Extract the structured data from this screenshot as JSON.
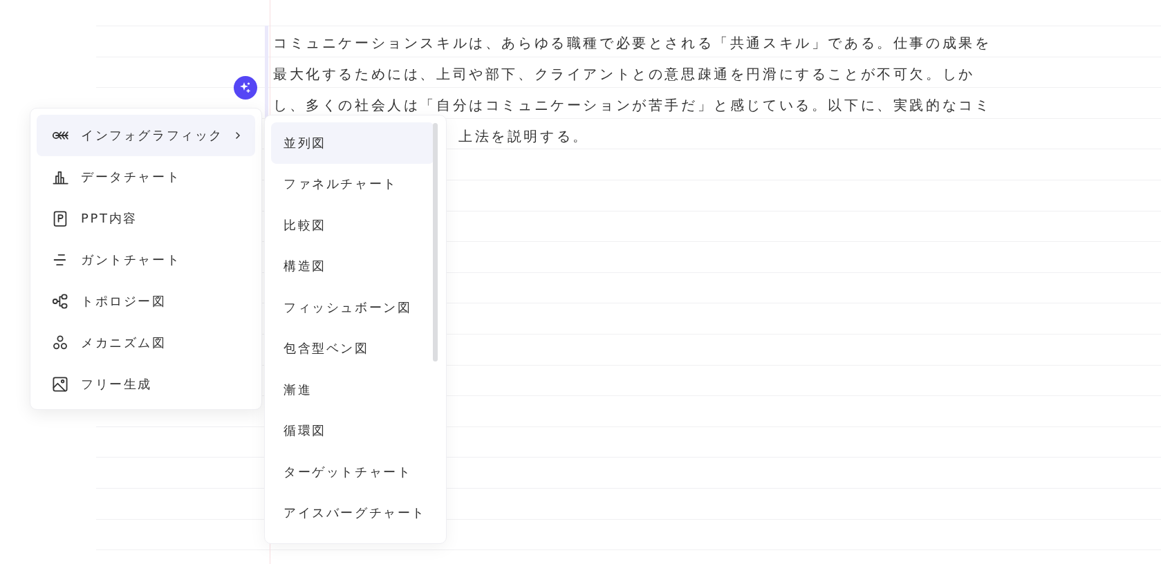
{
  "paragraph": {
    "lines": [
      "コミュニケーションスキルは、あらゆる職種で必要とされる「共通スキル」である。仕事の成果を",
      "最大化するためには、上司や部下、クライアントとの意思疎通を円滑にすることが不可欠。しか",
      "し、多くの社会人は「自分はコミュニケーションが苦手だ」と感じている。以下に、実践的なコミ"
    ],
    "visible_tail": "上法を説明する。"
  },
  "menu": {
    "items": [
      {
        "label": "インフォグラフィック",
        "kind": "fishbone",
        "selected": true,
        "submenu": true
      },
      {
        "label": "データチャート",
        "kind": "bars",
        "selected": false,
        "submenu": false
      },
      {
        "label": "PPT内容",
        "kind": "document",
        "selected": false,
        "submenu": false
      },
      {
        "label": "ガントチャート",
        "kind": "gantt",
        "selected": false,
        "submenu": false
      },
      {
        "label": "トポロジー図",
        "kind": "topology",
        "selected": false,
        "submenu": false
      },
      {
        "label": "メカニズム図",
        "kind": "circles",
        "selected": false,
        "submenu": false
      },
      {
        "label": "フリー生成",
        "kind": "image",
        "selected": false,
        "submenu": false
      }
    ]
  },
  "submenu": {
    "items": [
      {
        "label": "並列図",
        "selected": true
      },
      {
        "label": "ファネルチャート",
        "selected": false
      },
      {
        "label": "比較図",
        "selected": false
      },
      {
        "label": "構造図",
        "selected": false
      },
      {
        "label": "フィッシュボーン図",
        "selected": false
      },
      {
        "label": "包含型ベン図",
        "selected": false
      },
      {
        "label": "漸進",
        "selected": false
      },
      {
        "label": "循環図",
        "selected": false
      },
      {
        "label": "ターゲットチャート",
        "selected": false
      },
      {
        "label": "アイスバーグチャート",
        "selected": false
      }
    ]
  }
}
